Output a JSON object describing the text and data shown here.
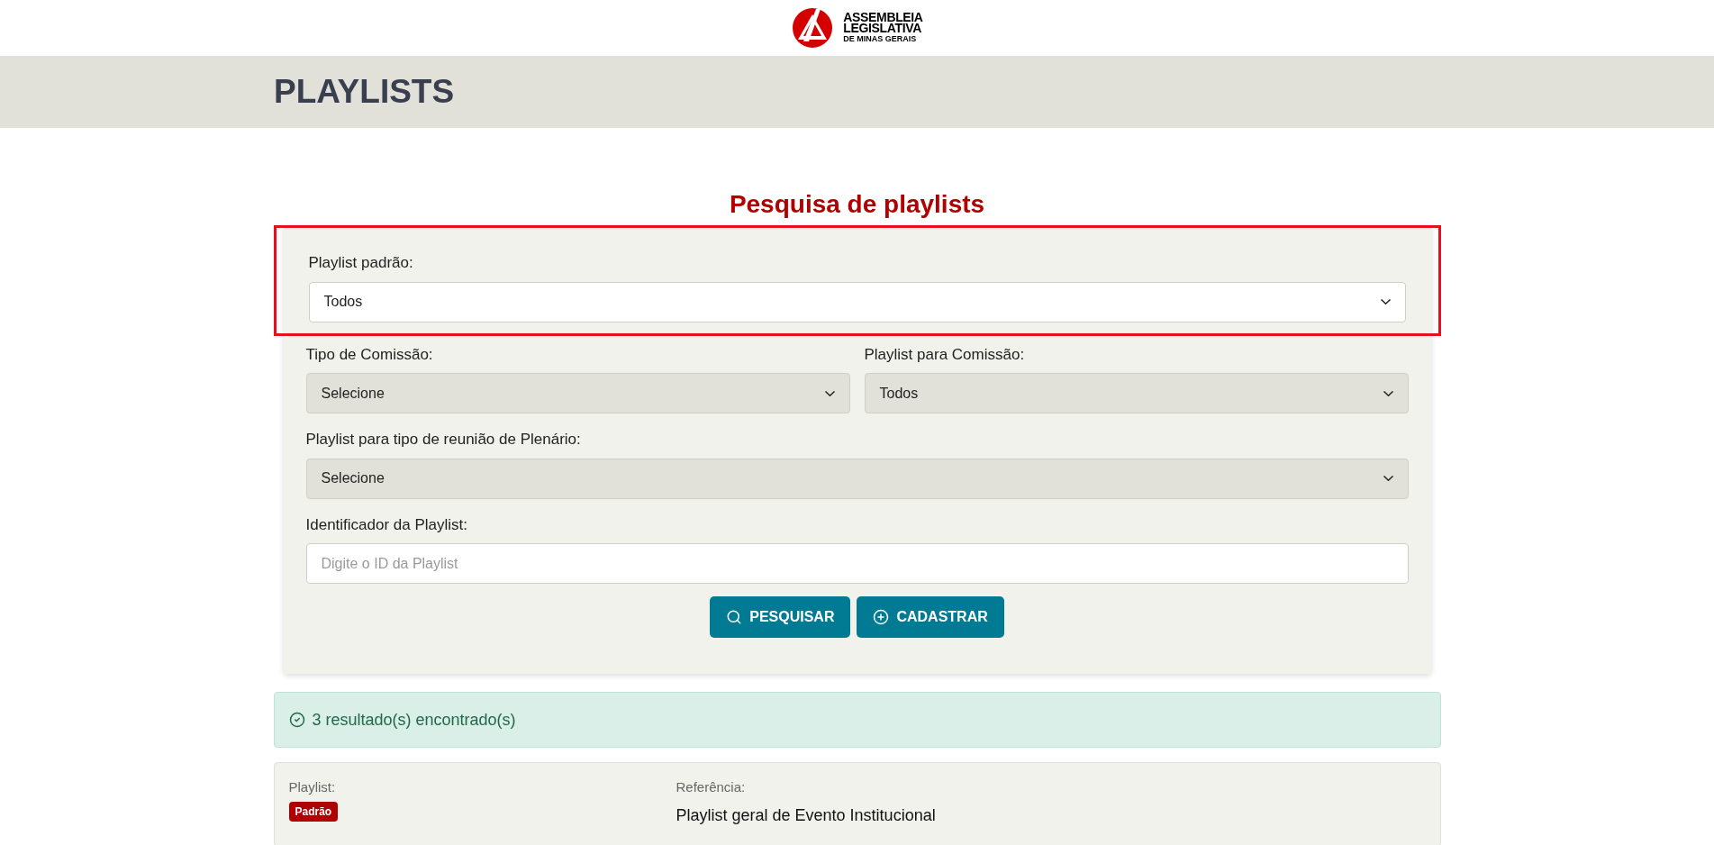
{
  "logo": {
    "lines": [
      "ASSEMBLEIA",
      "LEGISLATIVA",
      "DE MINAS GERAIS"
    ]
  },
  "page_title": "PLAYLISTS",
  "search": {
    "heading": "Pesquisa de playlists",
    "fields": [
      {
        "kind": "select",
        "label": "Playlist padrão:",
        "value": "Todos",
        "disabled": false
      },
      {
        "kind": "select",
        "label": "Tipo de Comissão:",
        "value": "Selecione",
        "disabled": true
      },
      {
        "kind": "select",
        "label": "Playlist para Comissão:",
        "value": "Todos",
        "disabled": true
      },
      {
        "kind": "select",
        "label": "Playlist para tipo de reunião de Plenário:",
        "value": "Selecione",
        "disabled": true
      },
      {
        "kind": "text",
        "label": "Identificador da Playlist:",
        "placeholder": "Digite o ID da Playlist"
      }
    ],
    "buttons": [
      {
        "kind": "search",
        "label": "PESQUISAR"
      },
      {
        "kind": "add",
        "label": "CADASTRAR"
      }
    ]
  },
  "alert": {
    "text": "3 resultado(s) encontrado(s)"
  },
  "results": [
    {
      "playlist_label": "Playlist:",
      "badge": "Padrão",
      "reference_label": "Referência:",
      "reference": "Playlist geral de Evento Institucional"
    }
  ]
}
